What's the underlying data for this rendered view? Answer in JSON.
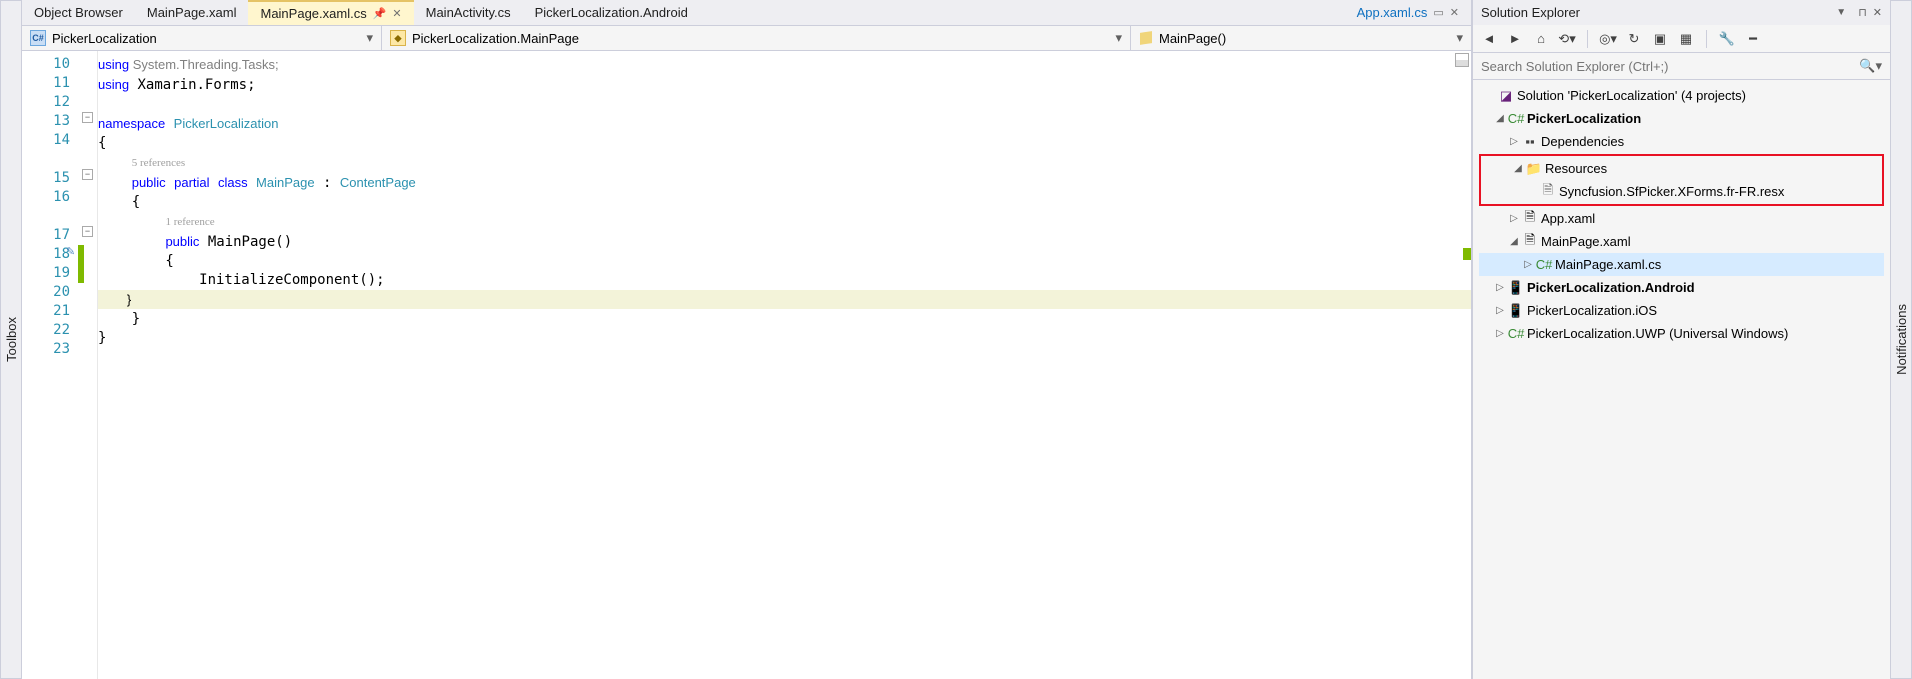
{
  "sidebars": {
    "left": "Toolbox",
    "right": "Notifications"
  },
  "tabs": [
    {
      "label": "Object Browser"
    },
    {
      "label": "MainPage.xaml"
    },
    {
      "label": "MainPage.xaml.cs",
      "active": true,
      "pin": true,
      "close": true
    },
    {
      "label": "MainActivity.cs"
    },
    {
      "label": "PickerLocalization.Android"
    },
    {
      "label": "App.xaml.cs",
      "preview": true,
      "close": true
    }
  ],
  "nav": {
    "ns": "PickerLocalization",
    "cls": "PickerLocalization.MainPage",
    "mbr": "MainPage()"
  },
  "code": {
    "start": 10,
    "lines": [
      "using System.Threading.Tasks;",
      "using Xamarin.Forms;",
      "",
      "namespace PickerLocalization",
      "{",
      "5 references",
      "    public partial class MainPage : ContentPage",
      "    {",
      "1 reference",
      "        public MainPage()",
      "        {",
      "            InitializeComponent();",
      "        }",
      "    }",
      "}",
      ""
    ]
  },
  "se": {
    "title": "Solution Explorer",
    "search_ph": "Search Solution Explorer (Ctrl+;)",
    "sol": "Solution 'PickerLocalization' (4 projects)",
    "n": {
      "proj": "PickerLocalization",
      "dep": "Dependencies",
      "res": "Resources",
      "resx": "Syncfusion.SfPicker.XForms.fr-FR.resx",
      "app": "App.xaml",
      "mp": "MainPage.xaml",
      "mpcs": "MainPage.xaml.cs",
      "and": "PickerLocalization.Android",
      "ios": "PickerLocalization.iOS",
      "uwp": "PickerLocalization.UWP (Universal Windows)"
    }
  }
}
